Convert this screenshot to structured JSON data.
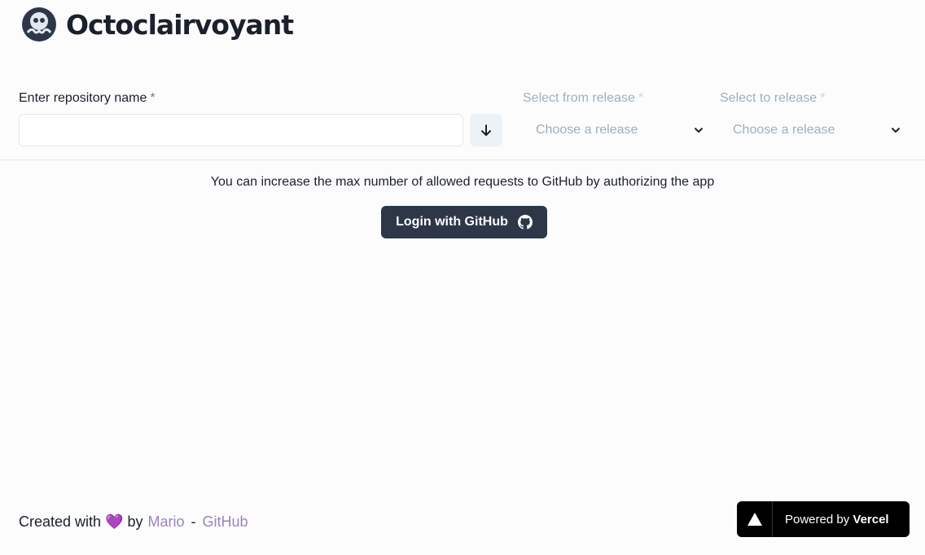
{
  "header": {
    "title": "Octoclairvoyant",
    "logo_icon": "octocat-crystal-ball-icon"
  },
  "form": {
    "repo_label": "Enter repository name",
    "required_mark": "*",
    "repo_value": "",
    "repo_placeholder": "",
    "from_label": "Select from release",
    "to_label": "Select to release",
    "from_placeholder": "Choose a release",
    "to_placeholder": "Choose a release"
  },
  "auth": {
    "notice": "You can increase the max number of allowed requests to GitHub by authorizing the app",
    "login_label": "Login with GitHub"
  },
  "footer": {
    "created_with": "Created with",
    "heart": "💜",
    "by": "by",
    "author": "Mario",
    "separator": "-",
    "github_link": "GitHub"
  },
  "vercel": {
    "powered_by": "Powered by",
    "brand": "Vercel"
  },
  "colors": {
    "primary_button": "#2d3748",
    "link": "#8a6fb0",
    "disabled_text": "#a0aec0"
  }
}
